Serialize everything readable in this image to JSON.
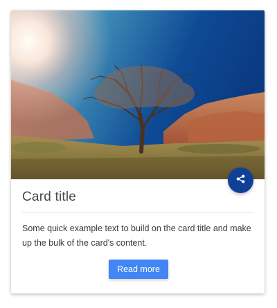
{
  "card": {
    "image_alt": "Lone tree in a desert valley under a sunlit sky",
    "title": "Card title",
    "text": "Some quick example text to build on the card title and make up the bulk of the card's content.",
    "button_label": "Read more",
    "share_icon": "share-icon"
  },
  "colors": {
    "share_button": "#103f98",
    "read_more_button": "#4285f4"
  }
}
